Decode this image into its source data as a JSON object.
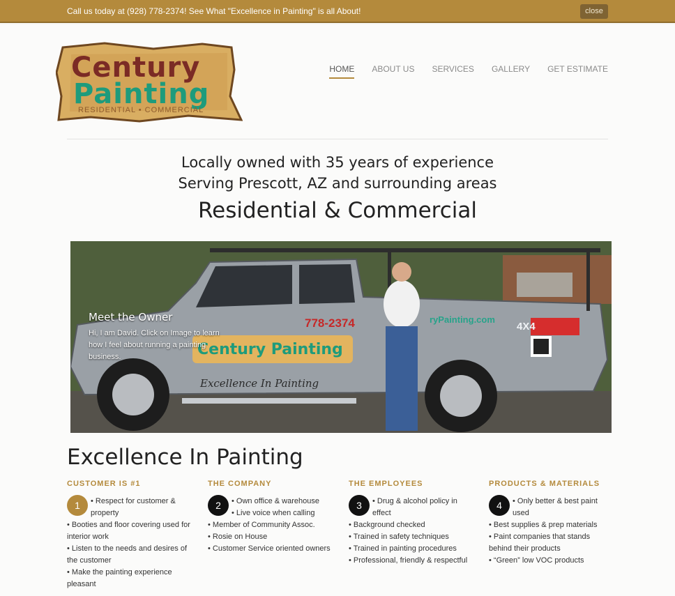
{
  "announcement": {
    "text": "Call us today at (928) 778-2374! See What \"Excellence in Painting\" is all About!",
    "close_label": "close"
  },
  "logo": {
    "line1": "Century",
    "line2": "Painting",
    "subline": "RESIDENTIAL • COMMERCIAL"
  },
  "nav": {
    "items": [
      {
        "label": "HOME"
      },
      {
        "label": "ABOUT US"
      },
      {
        "label": "SERVICES"
      },
      {
        "label": "GALLERY"
      },
      {
        "label": "GET ESTIMATE"
      }
    ]
  },
  "hero": {
    "tagline1": "Locally owned with 35 years of experience",
    "tagline2": "Serving Prescott, AZ and surrounding areas",
    "tagline3": "Residential & Commercial",
    "title": "Meet the Owner",
    "text": "Hi, I am David. Click on Image to learn how I feel about running a painting business.",
    "truck_phone": "778-2374",
    "truck_brand": "Century Painting",
    "truck_motto": "Excellence In Painting",
    "truck_site": "ryPainting.com",
    "truck_badge": "4X4"
  },
  "section": {
    "heading": "Excellence In Painting"
  },
  "columns": [
    {
      "title": "CUSTOMER IS #1",
      "number": "1",
      "items": [
        "Respect for customer & property",
        "Booties and floor covering used for interior work",
        "Listen to the needs and desires of the customer",
        "Make the painting experience pleasant"
      ]
    },
    {
      "title": "THE COMPANY",
      "number": "2",
      "items": [
        "Own office & warehouse",
        "Live voice when calling",
        "Member of Community Assoc.",
        "Rosie on House",
        "Customer Service oriented owners"
      ]
    },
    {
      "title": "THE EMPLOYEES",
      "number": "3",
      "items": [
        "Drug & alcohol policy in effect",
        "Background checked",
        "Trained in safety techniques",
        "Trained in painting procedures",
        "Professional, friendly & respectful"
      ]
    },
    {
      "title": "PRODUCTS & MATERIALS",
      "number": "4",
      "items": [
        "Only better & best paint used",
        "Best supplies & prep materials",
        "Paint companies that stands behind their products",
        "“Green” low VOC products"
      ]
    }
  ],
  "colors": {
    "accent": "#b48a3c",
    "logo_red": "#7b2b25",
    "logo_green": "#1e9b7c"
  }
}
